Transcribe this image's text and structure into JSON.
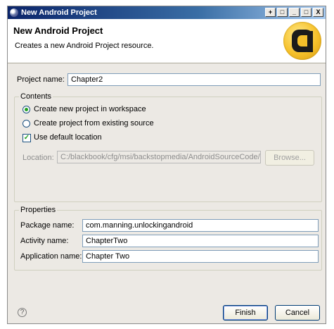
{
  "window": {
    "title": "New Android Project",
    "controls": {
      "minimize": "_",
      "maximize": "□",
      "close": "X",
      "extra1": "+",
      "extra2": "□"
    }
  },
  "banner": {
    "title": "New Android Project",
    "description": "Creates a new Android Project resource."
  },
  "project_name": {
    "label": "Project name:",
    "value": "Chapter2"
  },
  "contents": {
    "legend": "Contents",
    "radio_new": "Create new project in workspace",
    "radio_existing": "Create project from existing source",
    "checkbox_default": "Use default location",
    "location_label": "Location:",
    "location_value": "C:/blackbook/cfg/msi/backstopmedia/AndroidSourceCode/Chapt",
    "browse_label": "Browse..."
  },
  "properties": {
    "legend": "Properties",
    "package": {
      "label": "Package name:",
      "value": "com.manning.unlockingandroid"
    },
    "activity": {
      "label": "Activity name:",
      "value": "ChapterTwo"
    },
    "application": {
      "label": "Application name:",
      "value": "Chapter Two"
    }
  },
  "footer": {
    "help": "?",
    "finish_label": "Finish",
    "cancel_label": "Cancel"
  },
  "colors": {
    "accent": "#0a246a",
    "check_green": "#21a121",
    "logo_gold": "#f6c12a"
  }
}
